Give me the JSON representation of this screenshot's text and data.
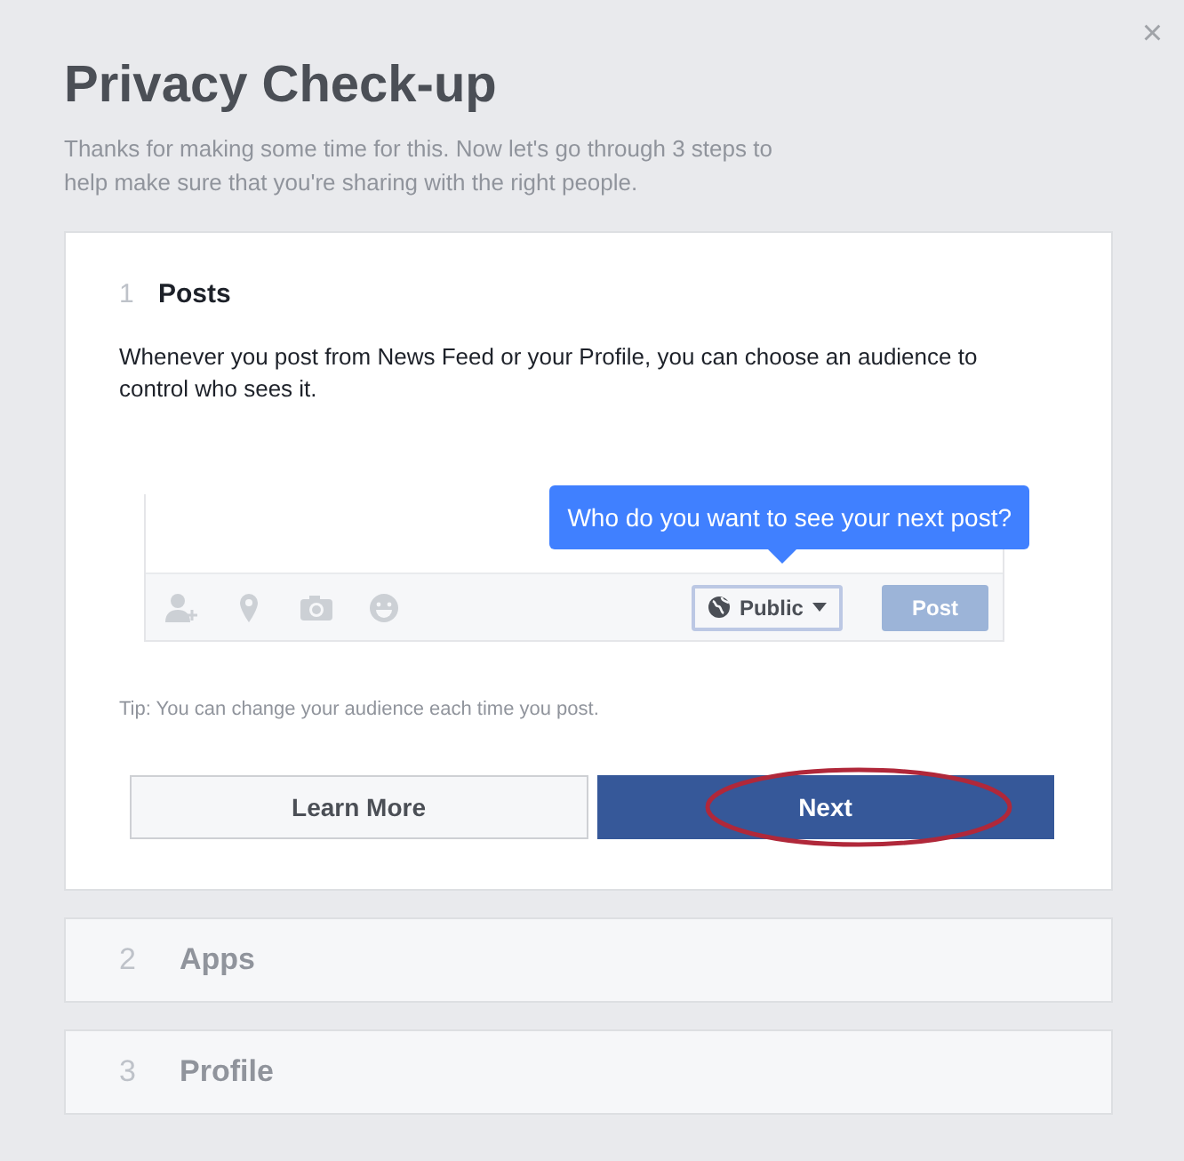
{
  "dialog": {
    "title": "Privacy Check-up",
    "subtitle": "Thanks for making some time for this. Now let's go through 3 steps to help make sure that you're sharing with the right people.",
    "close": "×"
  },
  "steps": [
    {
      "number": "1",
      "title": "Posts",
      "expanded": true,
      "description": "Whenever you post from News Feed or your Profile, you can choose an audience to control who sees it.",
      "tooltip": "Who do you want to see your next post?",
      "audience": "Public",
      "post_button": "Post",
      "tip": "Tip: You can change your audience each time you post.",
      "buttons": [
        {
          "label": "Learn More",
          "kind": "secondary",
          "highlighted": false
        },
        {
          "label": "Next",
          "kind": "primary",
          "highlighted": true
        }
      ]
    },
    {
      "number": "2",
      "title": "Apps",
      "expanded": false
    },
    {
      "number": "3",
      "title": "Profile",
      "expanded": false
    }
  ]
}
